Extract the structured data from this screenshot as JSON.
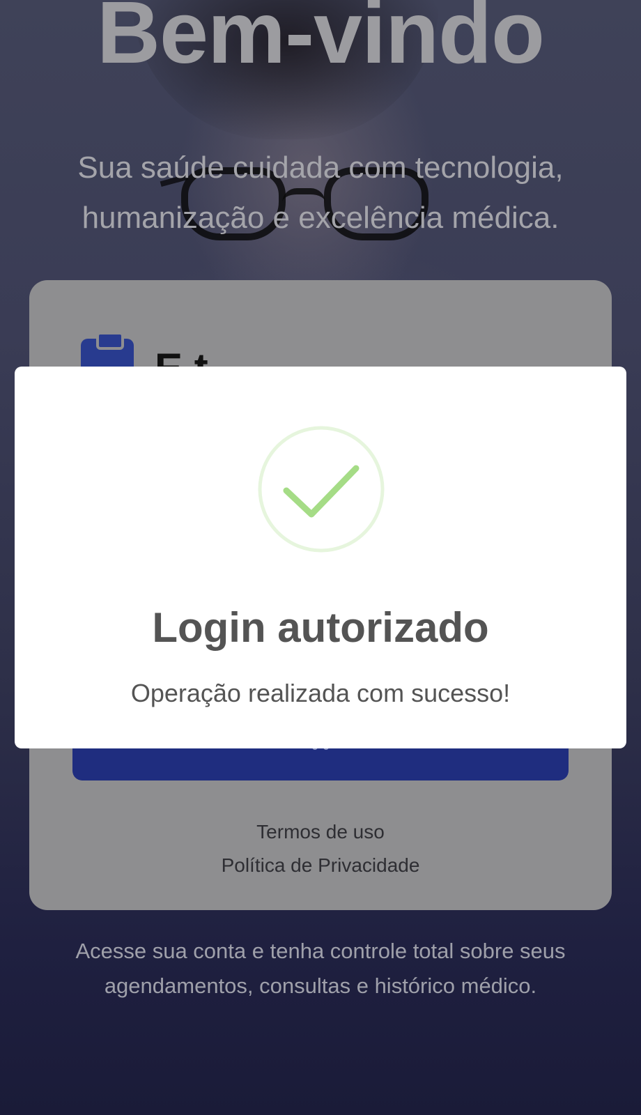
{
  "hero": {
    "title": "Bem-vindo",
    "subtitle_line1": "Sua saúde cuidada com tecnologia,",
    "subtitle_line2": "humanização e excelência médica."
  },
  "card": {
    "heading_fragment": "E t",
    "links": {
      "terms": "Termos de uso",
      "privacy": "Política de Privacidade"
    }
  },
  "footer": {
    "line1": "Acesse sua conta e tenha controle total sobre seus",
    "line2": "agendamentos, consultas e histórico médico."
  },
  "modal": {
    "title": "Login autorizado",
    "message": "Operação realizada com sucesso!",
    "icon": "checkmark-success-icon"
  },
  "colors": {
    "success_green": "#a5dc86",
    "success_ring": "#e6f5dd",
    "primary_button": "#1f2d7f",
    "card_icon": "#283b8f"
  }
}
